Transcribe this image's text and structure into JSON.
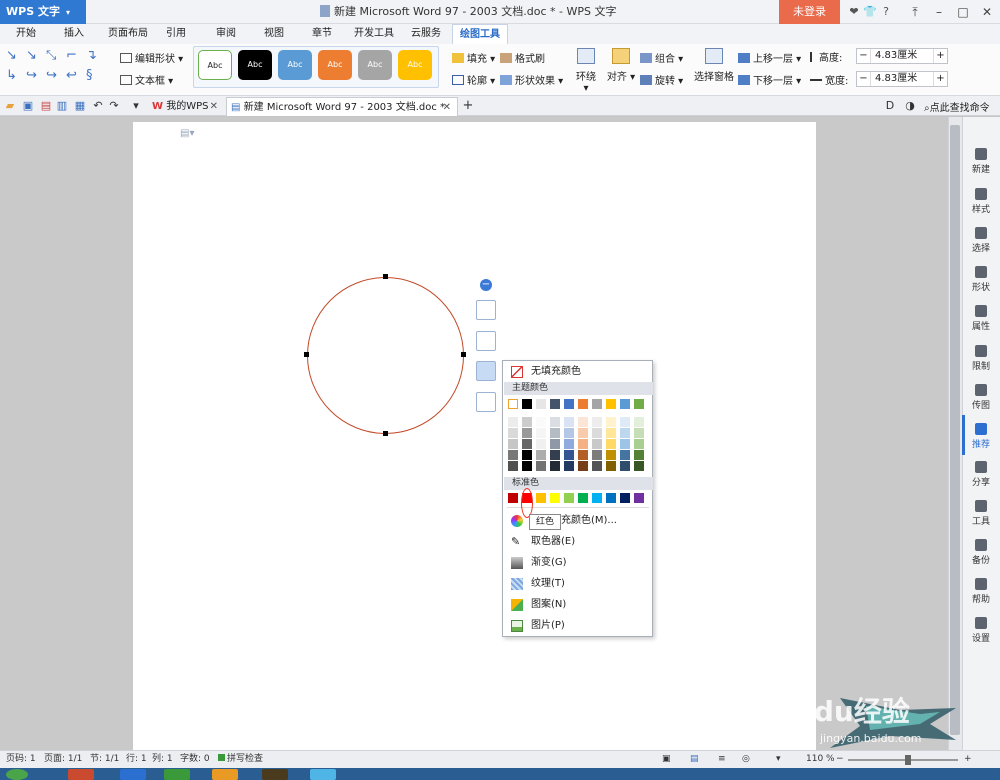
{
  "titlebar": {
    "app_name": "WPS 文字",
    "doc_title": "新建 Microsoft Word 97 - 2003 文档.doc * - WPS 文字",
    "login_label": "未登录"
  },
  "menu": {
    "tabs": [
      "开始",
      "插入",
      "页面布局",
      "引用",
      "审阅",
      "视图",
      "章节",
      "开发工具",
      "云服务",
      "绘图工具"
    ],
    "active_tab": "绘图工具"
  },
  "ribbon": {
    "edit_shape": "编辑形状",
    "text_box": "文本框",
    "style_label": "Abc",
    "fill": "填充",
    "format_brush": "格式刷",
    "outline": "轮廓",
    "shape_effect": "形状效果",
    "wrap": "环绕",
    "align": "对齐",
    "group": "组合",
    "rotate": "旋转",
    "selection_pane": "选择窗格",
    "bring_forward": "上移一层",
    "send_backward": "下移一层",
    "height_label": "高度:",
    "width_label": "宽度:",
    "height_value": "4.83厘米",
    "width_value": "4.83厘米"
  },
  "doc_tabs": {
    "tab1": "我的WPS",
    "tab2": "新建 Microsoft Word 97 - 2003 文档.doc *",
    "search_cmd": "点此查找命令"
  },
  "sidebar": {
    "items": [
      "新建",
      "样式",
      "选择",
      "形状",
      "属性",
      "限制",
      "传图",
      "推荐",
      "分享",
      "工具",
      "备份",
      "帮助",
      "设置"
    ],
    "active": "推荐"
  },
  "color_menu": {
    "no_fill": "无填充颜色",
    "theme_header": "主题颜色",
    "standard_header": "标准色",
    "more_colors": "其他填充颜色(M)...",
    "eyedropper": "取色器(E)",
    "gradient": "渐变(G)",
    "texture": "纹理(T)",
    "pattern": "图案(N)",
    "picture": "图片(P)",
    "tooltip": "红色",
    "theme_top": [
      "#ffffff",
      "#000000",
      "#e7e6e6",
      "#44546a",
      "#4472c4",
      "#ed7d31",
      "#a5a5a5",
      "#ffc000",
      "#5b9bd5",
      "#70ad47"
    ],
    "standard": [
      "#c00000",
      "#ff0000",
      "#ffc000",
      "#ffff00",
      "#92d050",
      "#00b050",
      "#00b0f0",
      "#0070c0",
      "#002060",
      "#7030a0"
    ]
  },
  "statusbar": {
    "page_num": "页码: 1",
    "pages": "页面: 1/1",
    "section": "节: 1/1",
    "row": "行: 1",
    "col": "列: 1",
    "words": "字数: 0",
    "spell": "拼写检查",
    "zoom": "110 %"
  },
  "watermark": {
    "brand": "Baidu",
    "brand_cn": "经验",
    "url": "jingyan.baidu.com"
  }
}
